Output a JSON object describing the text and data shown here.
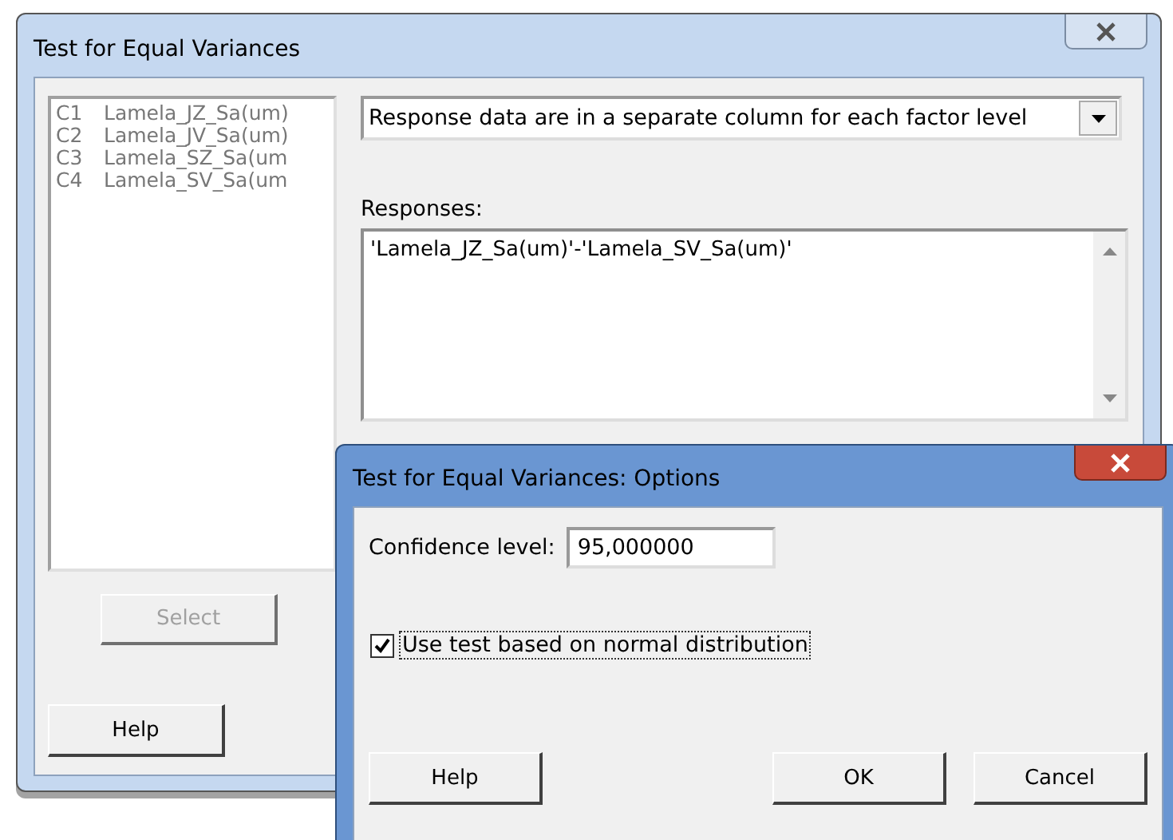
{
  "main_window": {
    "title": "Test for Equal Variances",
    "columns": [
      {
        "id": "C1",
        "name": "Lamela_JZ_Sa(um)"
      },
      {
        "id": "C2",
        "name": "Lamela_JV_Sa(um)"
      },
      {
        "id": "C3",
        "name": "Lamela_SZ_Sa(um"
      },
      {
        "id": "C4",
        "name": "Lamela_SV_Sa(um"
      }
    ],
    "data_arrangement": "Response data are in a separate column for each factor level",
    "responses_label": "Responses:",
    "responses": "'Lamela_JZ_Sa(um)'-'Lamela_SV_Sa(um)'",
    "select_button": {
      "label": "Select",
      "disabled": true
    },
    "help_button": "Help"
  },
  "options_dialog": {
    "title": "Test for Equal Variances: Options",
    "confidence_label": "Confidence level:",
    "confidence_value": "95,000000",
    "normal_test": {
      "label": "Use test based on normal distribution",
      "checked": true
    },
    "buttons": [
      {
        "label": "Help"
      },
      {
        "label": "OK"
      },
      {
        "label": "Cancel"
      }
    ]
  }
}
